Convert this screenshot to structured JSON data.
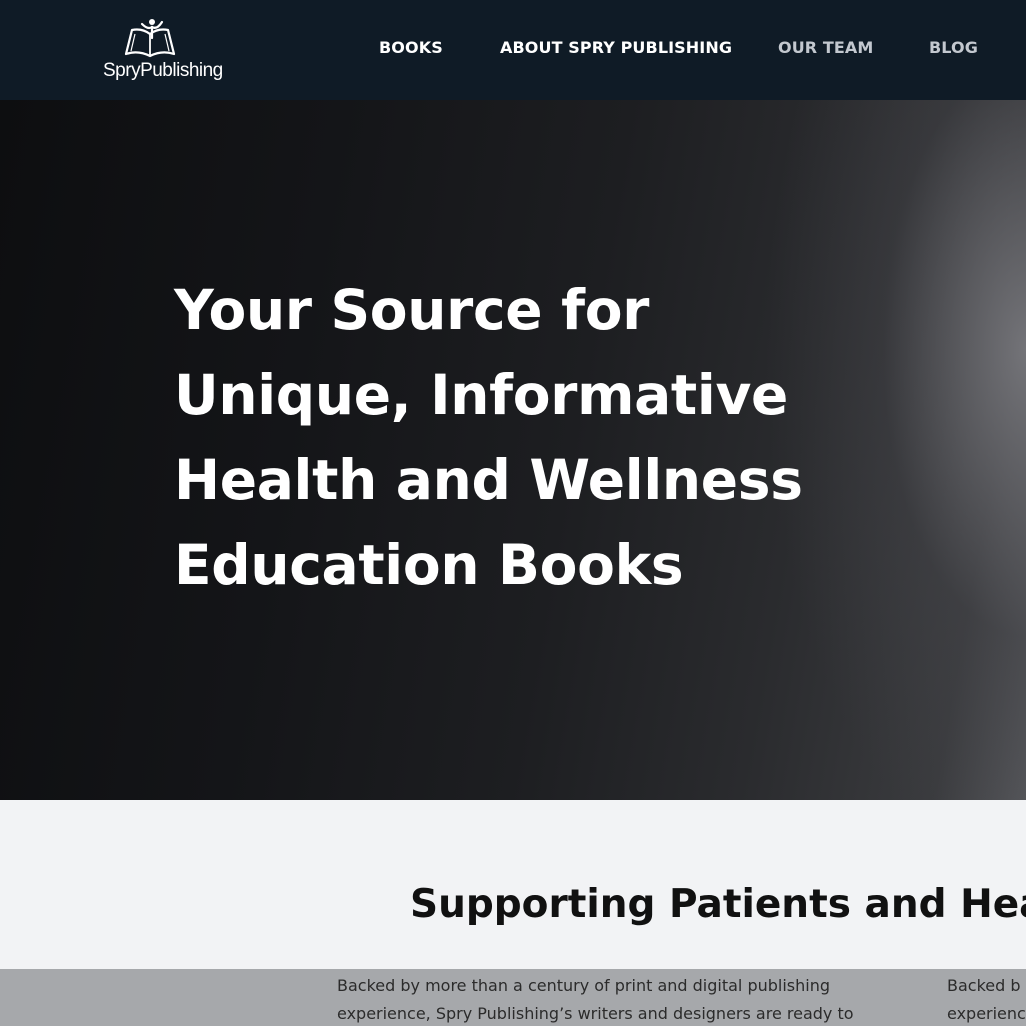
{
  "header": {
    "logo": {
      "text": "SpryPublishing",
      "icon": "open-book-person-icon"
    },
    "nav": [
      {
        "label": "BOOKS"
      },
      {
        "label": "ABOUT SPRY PUBLISHING"
      },
      {
        "label": "OUR TEAM"
      },
      {
        "label": "BLOG"
      }
    ]
  },
  "hero": {
    "title_lines": [
      "Your Source for",
      "Unique, Informative",
      "Health and Wellness",
      "Education Books"
    ]
  },
  "section": {
    "title": "Supporting Patients and Heal",
    "paragraph_left": [
      "Backed by more than a century of print and digital publishing",
      "experience, Spry Publishing’s writers and designers are ready to"
    ],
    "paragraph_right": [
      "Backed b",
      "experienc"
    ]
  },
  "colors": {
    "header_bg": "#0f1b26",
    "section_bg": "#f2f3f5",
    "band_bg": "#a6a8ab",
    "nav_active": "#ffffff",
    "nav_muted": "#c3c8cf"
  }
}
